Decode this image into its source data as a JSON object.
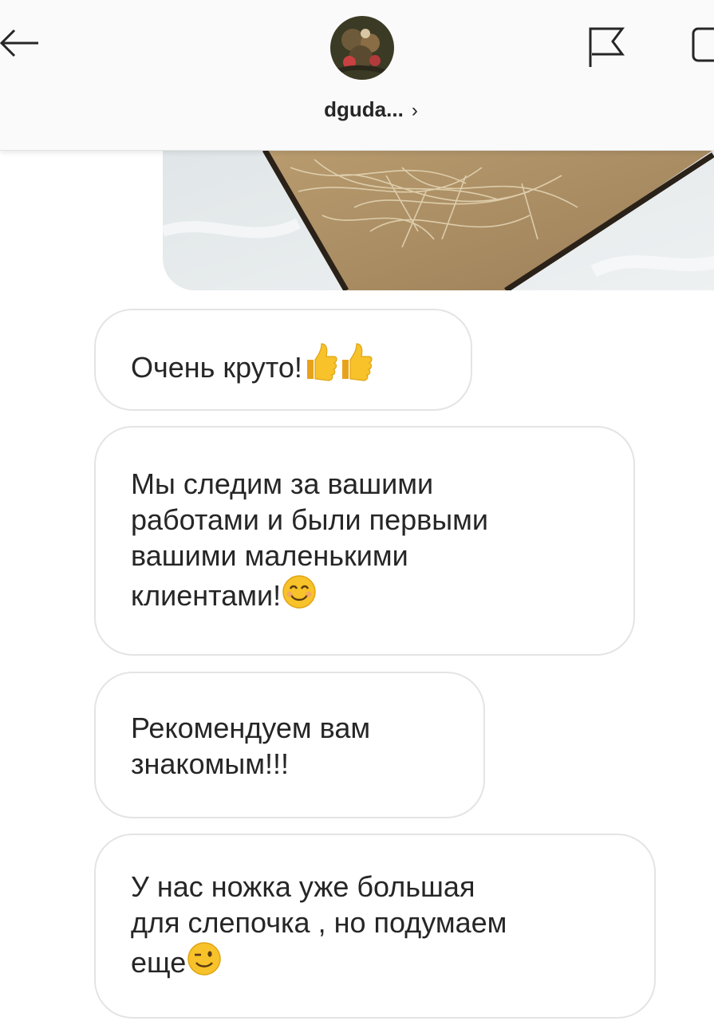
{
  "header": {
    "username": "dguda...",
    "chevron": "›",
    "icons": {
      "back": "arrow-left-icon",
      "flag": "flag-icon",
      "video": "video-call-icon"
    }
  },
  "shared_photo": {
    "kind": "image"
  },
  "messages": [
    {
      "text": "Очень круто!",
      "emoji": [
        "thumbs-up",
        "thumbs-up"
      ]
    },
    {
      "lines": [
        "Мы следим за вашими",
        "работами и были первыми",
        "вашими маленькими",
        "клиентами!"
      ],
      "emoji": [
        "smiling-face"
      ]
    },
    {
      "lines": [
        "Рекомендуем вам",
        "знакомым!!!"
      ]
    },
    {
      "lines": [
        "У нас ножка уже большая",
        "для слепочка , но подумаем",
        "еще"
      ],
      "emoji": [
        "winking-face"
      ]
    }
  ],
  "colors": {
    "header_bg": "#fafafa",
    "bubble_border": "#e4e4e4",
    "text": "#262626",
    "emoji_yellow": "#f7c22a"
  }
}
